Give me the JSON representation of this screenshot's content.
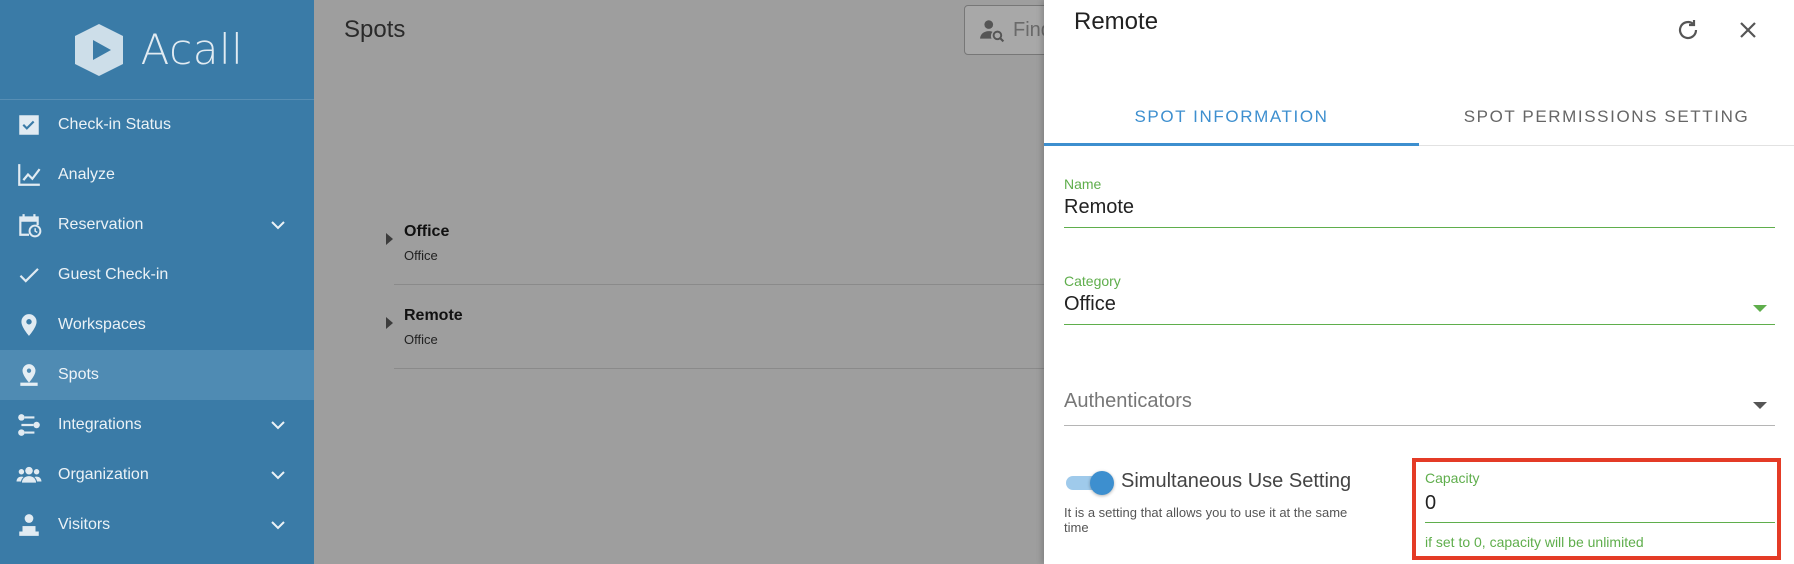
{
  "app": {
    "name": "Acall"
  },
  "sidebar": {
    "items": [
      {
        "label": "Check-in Status",
        "icon": "checkbox-icon",
        "expandable": false
      },
      {
        "label": "Analyze",
        "icon": "chart-line-icon",
        "expandable": false
      },
      {
        "label": "Reservation",
        "icon": "calendar-clock-icon",
        "expandable": true
      },
      {
        "label": "Guest Check-in",
        "icon": "check-icon",
        "expandable": false
      },
      {
        "label": "Workspaces",
        "icon": "map-pin-icon",
        "expandable": false
      },
      {
        "label": "Spots",
        "icon": "spot-pin-icon",
        "expandable": false,
        "active": true
      },
      {
        "label": "Integrations",
        "icon": "integrations-icon",
        "expandable": true
      },
      {
        "label": "Organization",
        "icon": "people-icon",
        "expandable": true
      },
      {
        "label": "Visitors",
        "icon": "visitor-icon",
        "expandable": true
      }
    ]
  },
  "main": {
    "title": "Spots",
    "search_placeholder": "Find",
    "spots": [
      {
        "name": "Office",
        "category": "Office"
      },
      {
        "name": "Remote",
        "category": "Office"
      }
    ]
  },
  "panel": {
    "title": "Remote",
    "tabs": [
      {
        "label": "SPOT INFORMATION",
        "active": true
      },
      {
        "label": "SPOT PERMISSIONS SETTING",
        "active": false
      }
    ],
    "name_field": {
      "label": "Name",
      "value": "Remote"
    },
    "category_field": {
      "label": "Category",
      "value": "Office"
    },
    "authenticators_field": {
      "label": "Authenticators"
    },
    "simultaneous": {
      "label": "Simultaneous Use Setting",
      "help": "It is a setting that allows you to use it at the same time",
      "enabled": true
    },
    "capacity": {
      "label": "Capacity",
      "value": "0",
      "help": "if set to 0, capacity will be unlimited"
    }
  },
  "colors": {
    "sidebar_bg": "#3a7ba7",
    "accent_blue": "#3d8fcf",
    "accent_green": "#5fae4c",
    "highlight_red": "#e43b26"
  }
}
